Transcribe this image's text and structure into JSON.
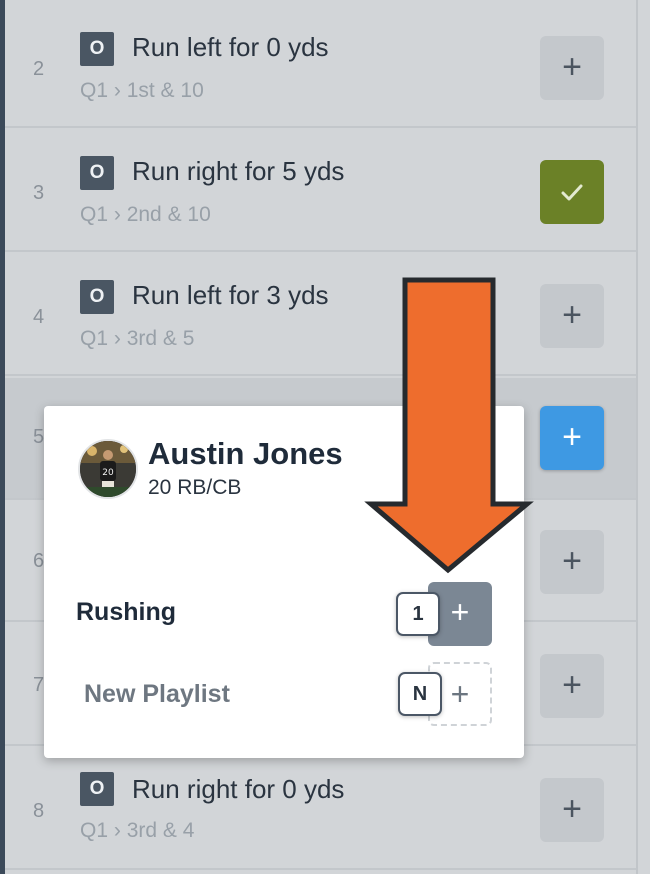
{
  "plays": [
    {
      "num": "2",
      "badge": "O",
      "title": "Run left for 0 yds",
      "quarter": "Q1",
      "situation": "1st & 10",
      "state": "add"
    },
    {
      "num": "3",
      "badge": "O",
      "title": "Run right for 5 yds",
      "quarter": "Q1",
      "situation": "2nd & 10",
      "state": "checked"
    },
    {
      "num": "4",
      "badge": "O",
      "title": "Run left for 3 yds",
      "quarter": "Q1",
      "situation": "3rd & 5",
      "state": "add"
    },
    {
      "num": "5",
      "badge": "",
      "title": "",
      "quarter": "",
      "situation": "",
      "state": "active"
    },
    {
      "num": "6",
      "badge": "",
      "title": "",
      "quarter": "",
      "situation": "",
      "state": "add"
    },
    {
      "num": "7",
      "badge": "",
      "title": "",
      "quarter": "",
      "situation": "",
      "state": "add"
    },
    {
      "num": "8",
      "badge": "O",
      "title": "Run right for 0 yds",
      "quarter": "Q1",
      "situation": "3rd & 4",
      "state": "add"
    }
  ],
  "separator": "›",
  "icons": {
    "add": "plus-icon",
    "checked": "check-icon"
  },
  "popup": {
    "player_name": "Austin Jones",
    "player_meta": "20 RB/CB",
    "playlists": [
      {
        "name": "Rushing",
        "count": "1",
        "added": true
      },
      {
        "name": "New Playlist",
        "count": "N",
        "added": false
      }
    ]
  },
  "colors": {
    "accent_blue": "#3e99e3",
    "checked_green": "#6b8127",
    "annotation_arrow": "#ee6d2d"
  }
}
